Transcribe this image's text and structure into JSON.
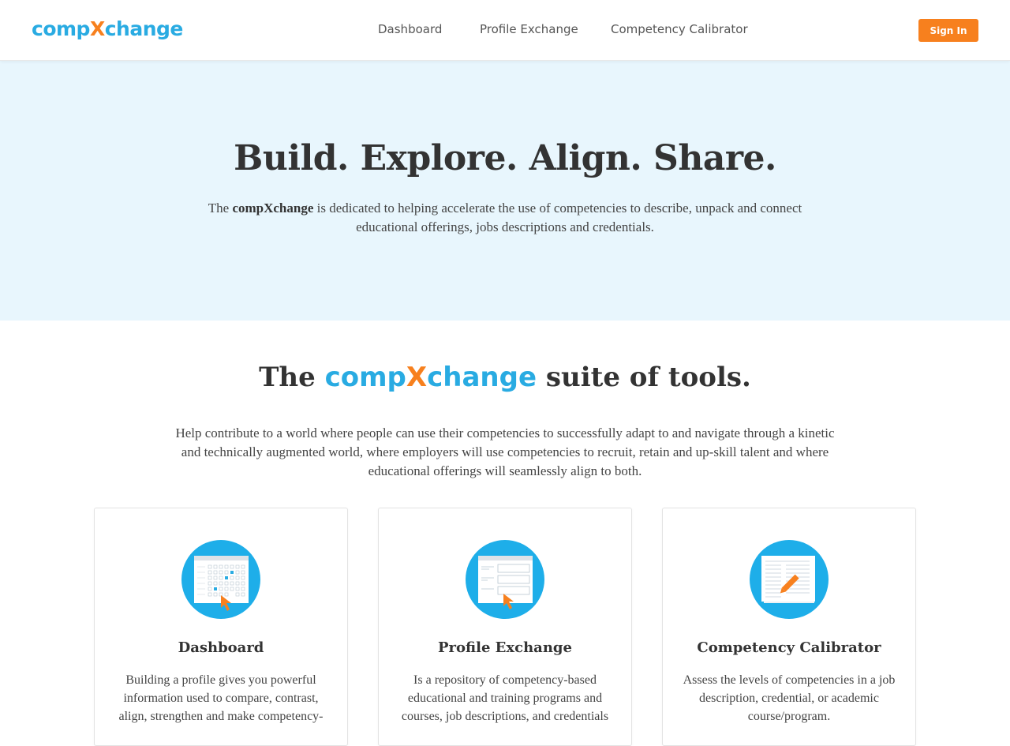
{
  "header": {
    "logo": {
      "part1": "comp",
      "part2": "X",
      "part3": "change"
    },
    "nav": [
      {
        "label": "Dashboard"
      },
      {
        "label": "Profile Exchange"
      },
      {
        "label": "Competency Calibrator"
      }
    ],
    "signin_label": "Sign In"
  },
  "hero": {
    "title": "Build. Explore. Align. Share.",
    "text_pre": "The ",
    "text_brand": "compXchange",
    "text_post": " is dedicated to helping accelerate the use of competencies to describe, unpack and connect educational offerings, jobs descriptions and credentials."
  },
  "suite": {
    "title_pre": "The ",
    "brand_part1": "comp",
    "brand_part2": "X",
    "brand_part3": "change",
    "title_post": " suite of tools.",
    "description": "Help contribute to a world where people can use their competencies to successfully adapt to and navigate through a kinetic and technically augmented world, where employers will use competencies to recruit, retain and up-skill talent and where educational offerings will seamlessly align to both."
  },
  "cards": [
    {
      "title": "Dashboard",
      "icon": "dashboard-grid-icon",
      "text": "Building a profile gives you powerful information used to compare, contrast, align, strengthen and make competency-"
    },
    {
      "title": "Profile Exchange",
      "icon": "profile-form-icon",
      "text": "Is a repository of competency-based educational and training programs and courses, job descriptions, and credentials"
    },
    {
      "title": "Competency Calibrator",
      "icon": "calibrator-document-icon",
      "text": "Assess the levels of competencies in a job description, credential, or academic course/program."
    }
  ],
  "colors": {
    "brand_blue": "#29abe2",
    "brand_orange": "#f7801e",
    "hero_bg": "#e8f6fd"
  }
}
